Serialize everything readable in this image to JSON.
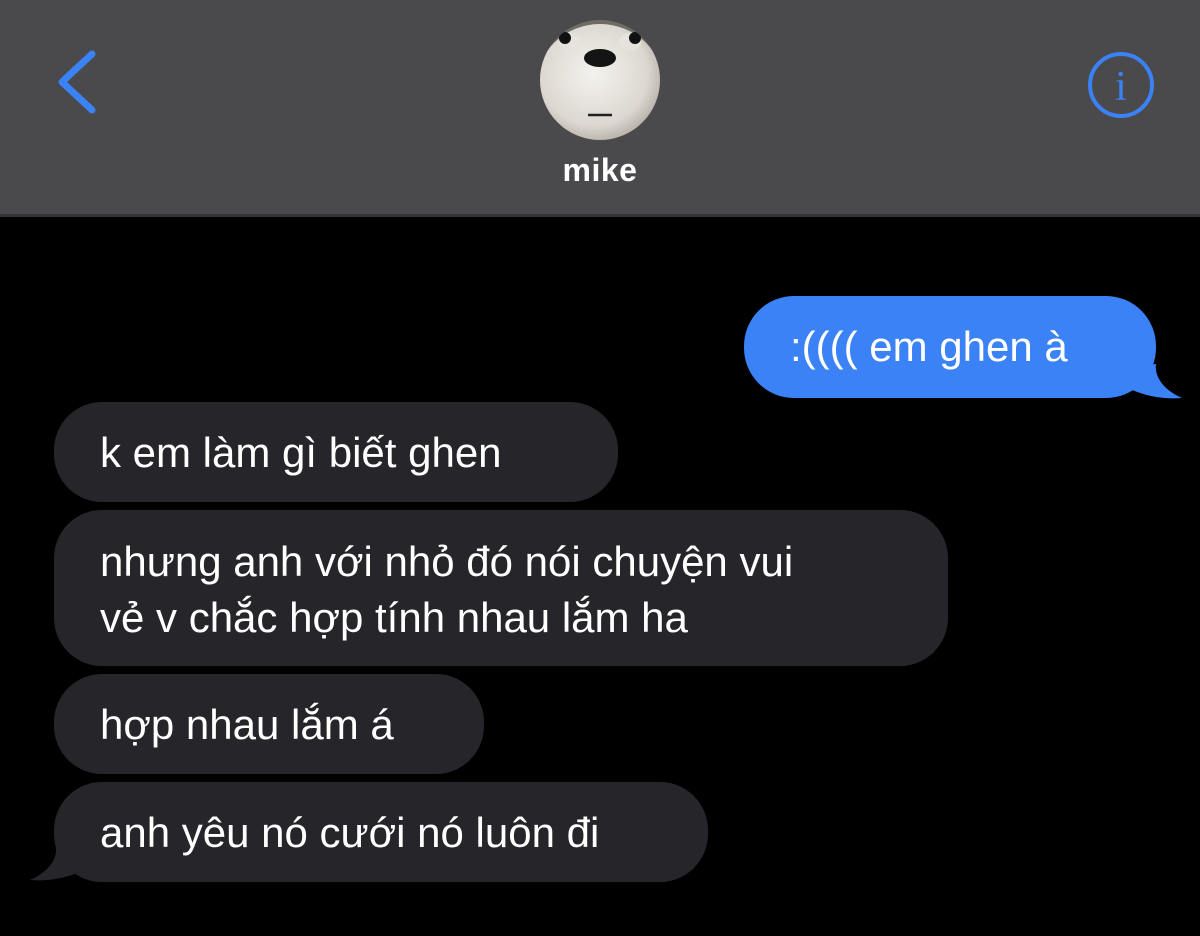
{
  "header": {
    "contact_name": "mike",
    "back_icon": "chevron-left-icon",
    "info_icon": "info-circle-icon",
    "info_glyph": "i",
    "accent_color": "#3a82f6"
  },
  "messages": [
    {
      "direction": "outgoing",
      "text": ":(((( em ghen à"
    },
    {
      "direction": "incoming",
      "text": "k em làm gì biết ghen"
    },
    {
      "direction": "incoming",
      "line1": "nhưng anh với nhỏ đó nói chuyện vui",
      "line2": "vẻ v chắc hợp tính nhau lắm ha"
    },
    {
      "direction": "incoming",
      "text": "hợp nhau lắm á"
    },
    {
      "direction": "incoming",
      "text": "anh yêu nó cưới nó luôn đi"
    }
  ],
  "colors": {
    "header_bg": "#4a4a4c",
    "background": "#000000",
    "outgoing_bubble": "#3a82f6",
    "incoming_bubble": "#26252a",
    "text": "#ffffff"
  }
}
